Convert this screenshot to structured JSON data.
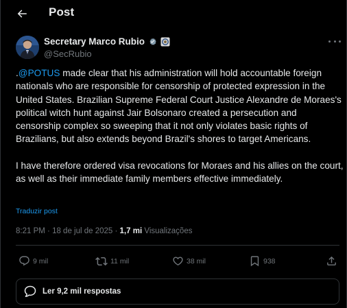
{
  "header": {
    "back_icon": "arrow-left-icon",
    "title": "Post"
  },
  "author": {
    "name": "Secretary Marco Rubio",
    "handle": "@SecRubio",
    "verified_icon": "verified-badge-icon",
    "affiliation_icon": "government-affiliation-icon",
    "more_icon": "more-horizontal-icon"
  },
  "post": {
    "text_prefix": ".",
    "mention": "@POTUS",
    "paragraph1_rest": " made clear that his administration will hold accountable foreign nationals who are responsible for censorship of protected expression in the United States. Brazilian Supreme Federal Court Justice Alexandre de Moraes's political witch hunt against Jair Bolsonaro created a persecution and censorship complex so sweeping that it not only violates basic rights of Brazilians, but also extends beyond Brazil's shores to target Americans.",
    "paragraph2": "I have therefore ordered visa revocations for Moraes and his allies on the court, as well as their immediate family members effective immediately.",
    "translate_label": "Traduzir post"
  },
  "meta": {
    "time": "8:21 PM",
    "separator": " · ",
    "date": "18 de jul de 2025",
    "views_count": "1,7 mi",
    "views_label": "Visualizações"
  },
  "actions": {
    "reply_count": "9 mil",
    "repost_count": "11 mil",
    "like_count": "38 mil",
    "bookmark_count": "938"
  },
  "replies_bar": {
    "label": "Ler 9,2 mil respostas",
    "icon": "speech-bubble-icon"
  },
  "colors": {
    "background": "#000000",
    "text": "#e7e9ea",
    "muted": "#71767b",
    "accent": "#1d9bf0",
    "border": "#2f3336"
  }
}
